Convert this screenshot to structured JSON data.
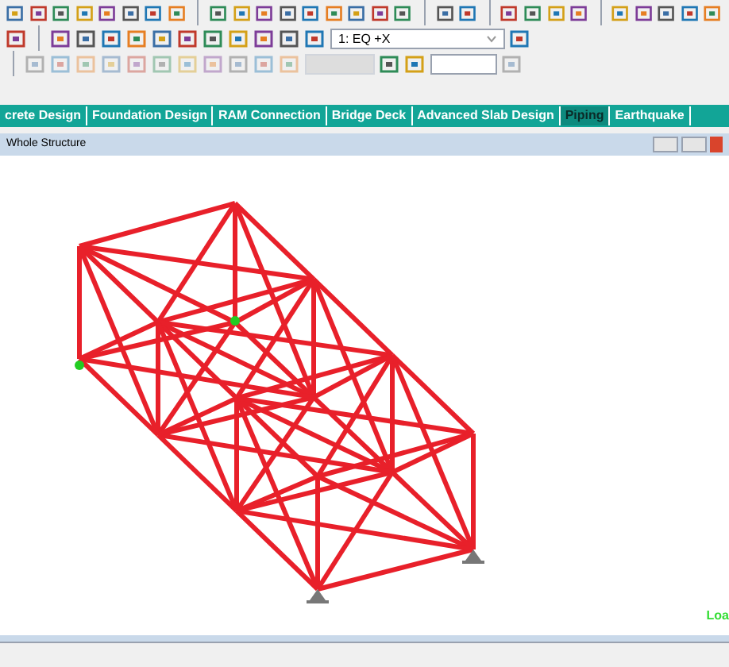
{
  "toolbar": {
    "load_case": "1: EQ +X"
  },
  "tabs": [
    {
      "label": "crete Design",
      "selected": false
    },
    {
      "label": "Foundation Design",
      "selected": false
    },
    {
      "label": "RAM Connection",
      "selected": false
    },
    {
      "label": "Bridge Deck",
      "selected": false
    },
    {
      "label": "Advanced Slab Design",
      "selected": false
    },
    {
      "label": "Piping",
      "selected": true
    },
    {
      "label": "Earthquake",
      "selected": false
    }
  ],
  "view_window": {
    "title": "Whole Structure",
    "status": "Loa"
  }
}
